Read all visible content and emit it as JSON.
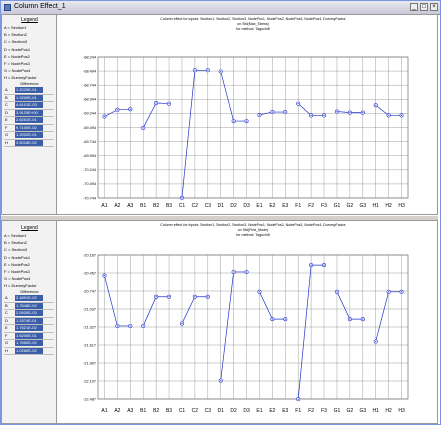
{
  "window": {
    "title": "Column Effect_1"
  },
  "panels": [
    {
      "legend": {
        "title": "Legend",
        "entries": [
          "A = Section1",
          "B = Section2",
          "C = Section3",
          "D = NodePos1",
          "E = NodePos2",
          "F = NodePos3",
          "G = NodePos4",
          "H = DummyFactor"
        ],
        "difference_title": "Difference",
        "differences": [
          {
            "key": "A",
            "value": "1.2025E-01"
          },
          {
            "key": "B",
            "value": "1.9209E-01"
          },
          {
            "key": "C",
            "value": "4.6101E-03"
          },
          {
            "key": "D",
            "value": "3.9129E+00"
          },
          {
            "key": "E",
            "value": "2.6251E-01"
          },
          {
            "key": "F",
            "value": "9.7100E-02"
          },
          {
            "key": "G",
            "value": "1.2002E-01"
          },
          {
            "key": "H",
            "value": "3.6018E-02"
          }
        ]
      },
      "chart_data": {
        "type": "line",
        "title_lines": [
          "Column effect for inputs: Section1, Section2, Section3, NodePos1, NodePos2, NodePos3, NodePos4, DummyFactor",
          "on Sfd(Max_Stress)",
          "for method: Taguchi8"
        ],
        "y_ticks": [
          "-68.244",
          "-68.494",
          "-68.744",
          "-68.994",
          "-69.244",
          "-69.494",
          "-69.744",
          "-69.994",
          "-70.244",
          "-70.494",
          "-70.744"
        ],
        "ylim": [
          -70.744,
          -68.244
        ],
        "x_ticks": [
          "A1",
          "A2",
          "A3",
          "B1",
          "B2",
          "B3",
          "C1",
          "C2",
          "C3",
          "D1",
          "D2",
          "D3",
          "E1",
          "E2",
          "E3",
          "F1",
          "F2",
          "F3",
          "G1",
          "G2",
          "G3",
          "H1",
          "H2",
          "H3"
        ],
        "series": [
          {
            "values": [
              -69.3,
              -69.18,
              -69.17
            ]
          },
          {
            "values": [
              -69.5,
              -69.06,
              -69.07
            ]
          },
          {
            "values": [
              -70.74,
              -68.48,
              -68.48
            ]
          },
          {
            "values": [
              -68.5,
              -69.38,
              -69.38
            ]
          },
          {
            "values": [
              -69.27,
              -69.22,
              -69.22
            ]
          },
          {
            "values": [
              -69.07,
              -69.28,
              -69.28
            ]
          },
          {
            "values": [
              -69.21,
              -69.23,
              -69.23
            ]
          },
          {
            "values": [
              -69.1,
              -69.28,
              -69.28
            ]
          }
        ],
        "grid": true
      }
    },
    {
      "legend": {
        "title": "Legend",
        "entries": [
          "A = Section1",
          "B = Section2",
          "C = Section3",
          "D = NodePos1",
          "E = NodePos2",
          "F = NodePos3",
          "G = NodePos4",
          "H = DummyFactor"
        ],
        "difference_title": "Difference",
        "differences": [
          {
            "key": "A",
            "value": "2.4891E-02"
          },
          {
            "key": "B",
            "value": "1.7648E-02"
          },
          {
            "key": "C",
            "value": "2.5930E-03"
          },
          {
            "key": "D",
            "value": "1.1574E-01"
          },
          {
            "key": "E",
            "value": "1.7621E-02"
          },
          {
            "key": "F",
            "value": "1.6200E-01"
          },
          {
            "key": "G",
            "value": "1.7650E-02"
          },
          {
            "key": "H",
            "value": "1.0260E-02"
          }
        ]
      },
      "chart_data": {
        "type": "line",
        "title_lines": [
          "Column effect for inputs: Section1, Section2, Section3, NodePos1, NodePos2, NodePos3, NodePos4, DummyFactor",
          "on Sfd(First_Mode)",
          "for method: Taguchi8"
        ],
        "y_ticks": [
          "-20.167",
          "-20.457",
          "-20.747",
          "-21.037",
          "-21.327",
          "-21.617",
          "-21.907",
          "-22.197",
          "-22.487"
        ],
        "ylim": [
          -22.487,
          -20.167
        ],
        "x_ticks": [
          "A1",
          "A2",
          "A3",
          "B1",
          "B2",
          "B3",
          "C1",
          "C2",
          "C3",
          "D1",
          "D2",
          "D3",
          "E1",
          "E2",
          "E3",
          "F1",
          "F2",
          "F3",
          "G1",
          "G2",
          "G3",
          "H1",
          "H2",
          "H3"
        ],
        "series": [
          {
            "values": [
              -20.5,
              -21.31,
              -21.31
            ]
          },
          {
            "values": [
              -21.31,
              -20.84,
              -20.84
            ]
          },
          {
            "values": [
              -21.27,
              -20.84,
              -20.84
            ]
          },
          {
            "values": [
              -22.19,
              -20.44,
              -20.44
            ]
          },
          {
            "values": [
              -20.76,
              -21.2,
              -21.2
            ]
          },
          {
            "values": [
              -22.49,
              -20.33,
              -20.33
            ]
          },
          {
            "values": [
              -20.76,
              -21.2,
              -21.2
            ]
          },
          {
            "values": [
              -21.56,
              -20.76,
              -20.76
            ]
          }
        ],
        "grid": true
      }
    }
  ]
}
